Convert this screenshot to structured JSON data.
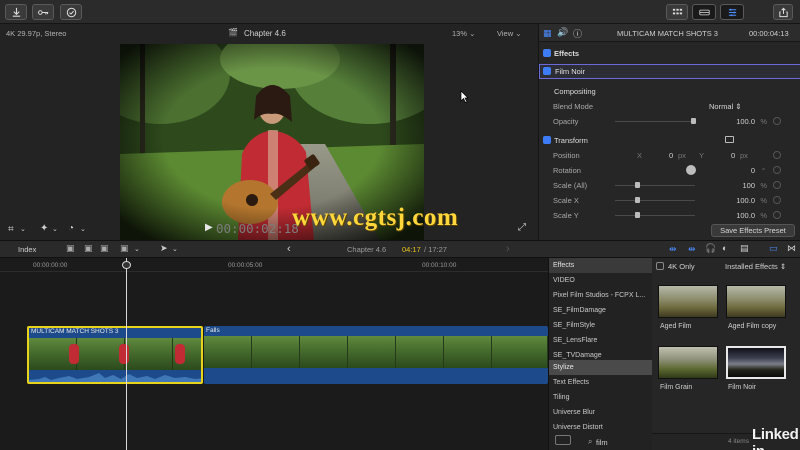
{
  "toolbar": {
    "import_icon": "download-icon",
    "keywords_icon": "key-icon",
    "background_tasks_icon": "checkmark-circle-icon",
    "share_icon": "share-icon"
  },
  "viewer": {
    "format_info": "4K 29.97p, Stereo",
    "clip_title": "Chapter 4.6",
    "zoom": "13%",
    "view_label": "View",
    "timecode": "00:00:02:18"
  },
  "inspector": {
    "duration": "00:00:04:13",
    "clip_name": "MULTICAM MATCH SHOTS 3",
    "effects_label": "Effects",
    "effect_name": "Film Noir",
    "compositing_label": "Compositing",
    "blend_mode_label": "Blend Mode",
    "blend_mode_value": "Normal",
    "opacity_label": "Opacity",
    "opacity_value": "100.0",
    "opacity_unit": "%",
    "transform_label": "Transform",
    "position_label": "Position",
    "position_x_label": "X",
    "position_x_value": "0",
    "position_x_unit": "px",
    "position_y_label": "Y",
    "position_y_value": "0",
    "position_y_unit": "px",
    "rotation_label": "Rotation",
    "rotation_value": "0",
    "rotation_unit": "°",
    "scale_all_label": "Scale (All)",
    "scale_all_value": "100",
    "scale_all_unit": "%",
    "scale_x_label": "Scale X",
    "scale_x_value": "100.0",
    "scale_x_unit": "%",
    "scale_y_label": "Scale Y",
    "scale_y_value": "100.0",
    "scale_y_unit": "%",
    "save_preset_label": "Save Effects Preset"
  },
  "timeline_header": {
    "index_label": "Index",
    "project_title": "Chapter 4.6",
    "current_time": "04:17",
    "total_time": "/ 17:27"
  },
  "timeline": {
    "ruler_marks": [
      "00:00:00:00",
      "00:00:05:00",
      "00:00:10:00"
    ],
    "clip1_name": "MULTICAM MATCH SHOTS 3",
    "clip2_name": "Falls"
  },
  "effects_browser": {
    "categories": [
      "Effects",
      "VIDEO",
      "Pixel Film Studios - FCPX L...",
      "SE_FilmDamage",
      "SE_FilmStyle",
      "SE_LensFlare",
      "SE_TVDamage",
      "Stylize",
      "Text Effects",
      "Tiling",
      "Universe Blur",
      "Universe Distort"
    ],
    "filter_4k_label": "4K Only",
    "installed_label": "Installed Effects",
    "thumbnails": [
      "Aged Film",
      "Aged Film copy",
      "Film Grain",
      "Film Noir"
    ],
    "search_value": "film",
    "items_count": "4 items"
  },
  "overlays": {
    "watermark": "www.cgtsj.com",
    "brand": "Linked in"
  },
  "colors": {
    "accent": "#3d7cf5",
    "clip_selected_border": "#e8d31c",
    "clip_blue": "#1d4a8a",
    "playhead": "#d8d8d8"
  }
}
